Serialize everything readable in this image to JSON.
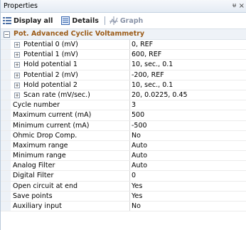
{
  "panel": {
    "title": "Properties",
    "pin_glyph": "ᵾ",
    "close_glyph": "×"
  },
  "toolbar": {
    "display_all": "Display all",
    "details": "Details",
    "graph": "Graph"
  },
  "group": {
    "title": "Pot. Advanced Cyclic Voltammetry",
    "expander": "−"
  },
  "rows": [
    {
      "name": "Potential 0 (mV)",
      "value": "0, REF",
      "expandable": true
    },
    {
      "name": "Potential 1 (mV)",
      "value": "600, REF",
      "expandable": true
    },
    {
      "name": "Hold potential 1",
      "value": "10, sec., 0.1",
      "expandable": true
    },
    {
      "name": "Potential 2 (mV)",
      "value": "-200, REF",
      "expandable": true
    },
    {
      "name": "Hold potential 2",
      "value": "10, sec., 0.1",
      "expandable": true
    },
    {
      "name": "Scan rate (mV/sec.)",
      "value": "20, 0.0225, 0.45",
      "expandable": true
    },
    {
      "name": "Cycle number",
      "value": "3",
      "expandable": false
    },
    {
      "name": "Maximum current (mA)",
      "value": "500",
      "expandable": false
    },
    {
      "name": "Minimum current (mA)",
      "value": "-500",
      "expandable": false
    },
    {
      "name": "Ohmic Drop Comp.",
      "value": "No",
      "expandable": false
    },
    {
      "name": "Maximum range",
      "value": "Auto",
      "expandable": false
    },
    {
      "name": "Minimum range",
      "value": "Auto",
      "expandable": false
    },
    {
      "name": "Analog Filter",
      "value": "Auto",
      "expandable": false
    },
    {
      "name": "Digital Filter",
      "value": "0",
      "expandable": false
    },
    {
      "name": "Open circuit at end",
      "value": "Yes",
      "expandable": false
    },
    {
      "name": "Save points",
      "value": "Yes",
      "expandable": false
    },
    {
      "name": "Auxiliary input",
      "value": "No",
      "expandable": false
    }
  ],
  "expander_plus": "+",
  "colors": {
    "group_title": "#9b5a16",
    "gutter": "#eef2f7"
  }
}
